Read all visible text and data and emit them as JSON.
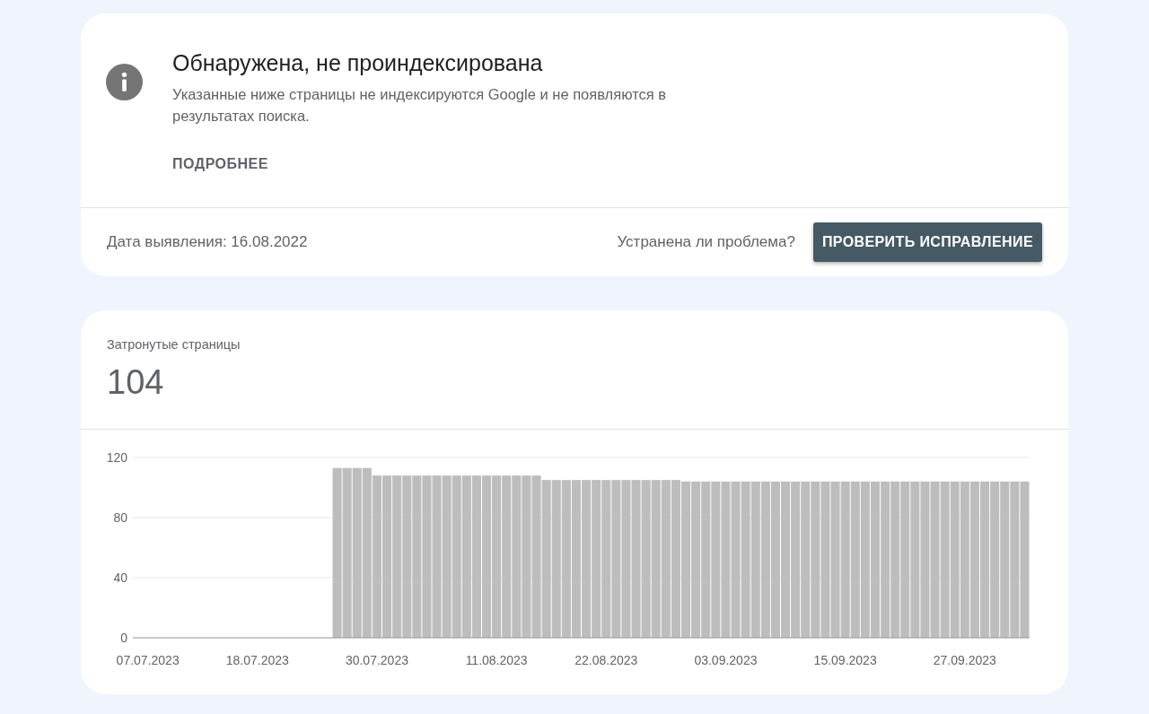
{
  "issue": {
    "title": "Обнаружена, не проиндексирована",
    "description": "Указанные ниже страницы не индексируются Google и не появляются в результатах поиска.",
    "more_link": "ПОДРОБНЕЕ",
    "detected": "Дата выявления: 16.08.2022",
    "question": "Устранена ли проблема?",
    "validate_button": "ПРОВЕРИТЬ ИСПРАВЛЕНИЕ"
  },
  "affected": {
    "label": "Затронутые страницы",
    "count": "104",
    "chart_data": {
      "type": "bar",
      "categories": [
        null,
        "07.07.2023",
        null,
        null,
        null,
        null,
        null,
        null,
        null,
        null,
        null,
        null,
        "18.07.2023",
        null,
        null,
        null,
        null,
        null,
        null,
        null,
        null,
        null,
        null,
        null,
        "30.07.2023",
        null,
        null,
        null,
        null,
        null,
        null,
        null,
        null,
        null,
        null,
        null,
        "11.08.2023",
        null,
        null,
        null,
        null,
        null,
        null,
        null,
        null,
        null,
        null,
        "22.08.2023",
        null,
        null,
        null,
        null,
        null,
        null,
        null,
        null,
        null,
        null,
        null,
        "03.09.2023",
        null,
        null,
        null,
        null,
        null,
        null,
        null,
        null,
        null,
        null,
        null,
        "15.09.2023",
        null,
        null,
        null,
        null,
        null,
        null,
        null,
        null,
        null,
        null,
        null,
        "27.09.2023",
        null,
        null,
        null,
        null,
        null,
        null
      ],
      "series": [
        {
          "color": "#bdbdbd",
          "values": [
            0,
            0,
            0,
            0,
            0,
            0,
            0,
            0,
            0,
            0,
            0,
            0,
            0,
            0,
            0,
            0,
            0,
            0,
            0,
            0,
            113,
            113,
            113,
            113,
            108,
            108,
            108,
            108,
            108,
            108,
            108,
            108,
            108,
            108,
            108,
            108,
            108,
            108,
            108,
            108,
            108,
            105,
            105,
            105,
            105,
            105,
            105,
            105,
            105,
            105,
            105,
            105,
            105,
            105,
            105,
            104,
            104,
            104,
            104,
            104,
            104,
            104,
            104,
            104,
            104,
            104,
            104,
            104,
            104,
            104,
            104,
            104,
            104,
            104,
            104,
            104,
            104,
            104,
            104,
            104,
            104,
            104,
            104,
            104,
            104,
            104,
            104,
            104,
            104,
            104
          ]
        }
      ],
      "ylim": [
        0,
        120
      ],
      "yticks": [
        0,
        40,
        80,
        120
      ]
    }
  }
}
